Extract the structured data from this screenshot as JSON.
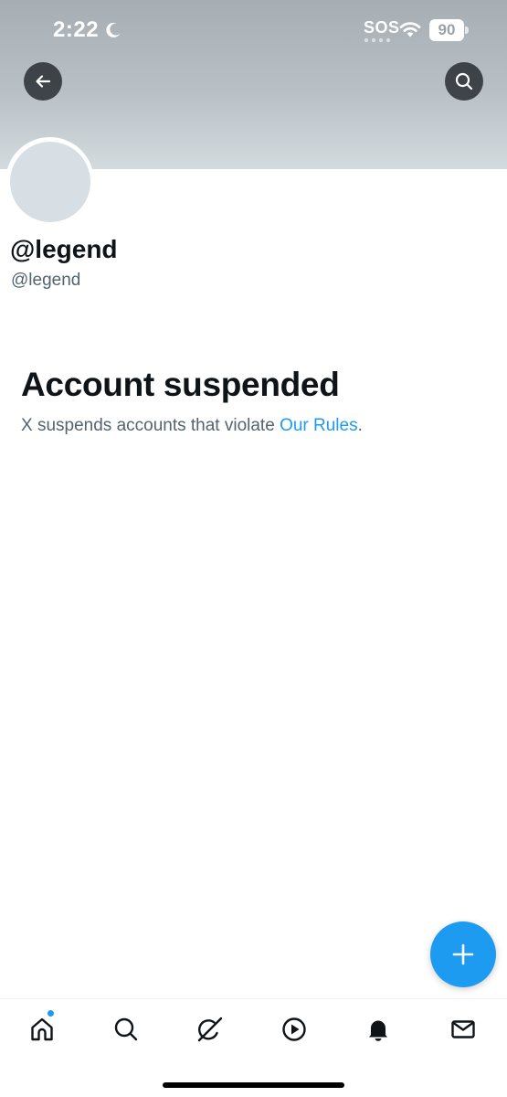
{
  "status_bar": {
    "time": "2:22",
    "sos": "SOS",
    "battery": "90",
    "icons": [
      "moon-icon",
      "wifi-icon",
      "battery-icon"
    ]
  },
  "profile": {
    "display_name": "@legend",
    "handle": "@legend"
  },
  "suspension": {
    "title": "Account suspended",
    "text_before": "X suspends accounts that violate ",
    "link": "Our Rules",
    "text_after": "."
  },
  "nav": {
    "icons": [
      "home-icon",
      "search-icon",
      "grok-icon",
      "video-icon",
      "bell-icon",
      "mail-icon"
    ],
    "home_has_notification": true
  },
  "colors": {
    "accent": "#1d9bf0",
    "primary_text": "#0f1419",
    "secondary_text": "#536471",
    "banner": "#b9c1c6"
  }
}
